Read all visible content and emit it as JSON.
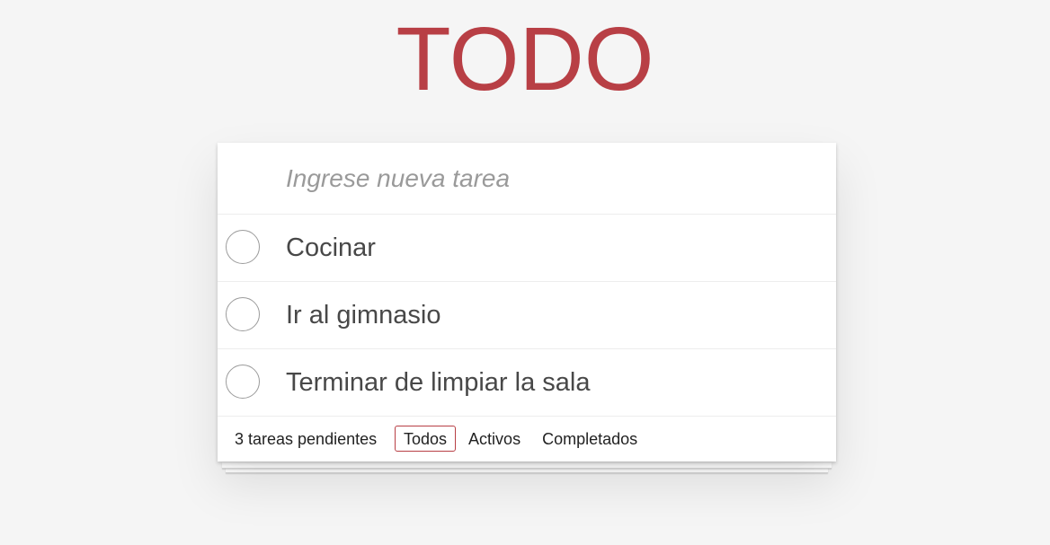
{
  "header": {
    "title": "TODO"
  },
  "new_todo": {
    "placeholder": "Ingrese nueva tarea",
    "value": ""
  },
  "todos": [
    {
      "label": "Cocinar",
      "completed": false
    },
    {
      "label": "Ir al gimnasio",
      "completed": false
    },
    {
      "label": "Terminar de limpiar la sala",
      "completed": false
    }
  ],
  "footer": {
    "count_text": "3 tareas pendientes",
    "filters": [
      {
        "label": "Todos",
        "selected": true
      },
      {
        "label": "Activos",
        "selected": false
      },
      {
        "label": "Completados",
        "selected": false
      }
    ]
  },
  "colors": {
    "accent": "#b83f45",
    "background": "#f5f5f5"
  }
}
